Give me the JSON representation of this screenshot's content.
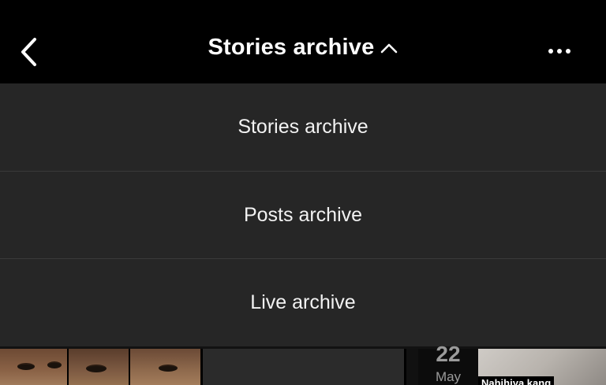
{
  "header": {
    "title": "Stories archive",
    "back_icon": "chevron-left-icon",
    "title_chevron_icon": "chevron-up-icon",
    "more_icon": "more-horizontal-icon"
  },
  "menu": {
    "items": [
      {
        "label": "Stories archive"
      },
      {
        "label": "Posts archive"
      },
      {
        "label": "Live archive"
      }
    ]
  },
  "grid": {
    "date_badge": {
      "day": "22",
      "month": "May"
    },
    "caption": "Nahihiya kang"
  },
  "colors": {
    "header_bg": "#000000",
    "menu_bg": "#262626",
    "divider": "#3a3a3a",
    "text": "#ffffff"
  }
}
